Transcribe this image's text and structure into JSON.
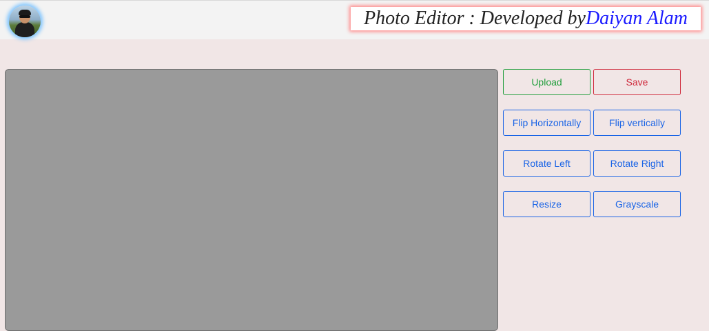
{
  "header": {
    "title_prefix": "Photo Editor : Developed by ",
    "author": "Daiyan Alam",
    "author_color": "#1a1aff",
    "title_glow_color": "#ff8a8a"
  },
  "controls": {
    "upload": "Upload",
    "save": "Save",
    "flip_horizontally": "Flip Horizontally",
    "flip_vertically": "Flip vertically",
    "rotate_left": "Rotate Left",
    "rotate_right": "Rotate Right",
    "resize": "Resize",
    "grayscale": "Grayscale"
  },
  "colors": {
    "primary": "#1a64e6",
    "success": "#1f9d3a",
    "danger": "#cf2a3c",
    "canvas": "#9a9a9a",
    "background": "#f1e6e6"
  }
}
